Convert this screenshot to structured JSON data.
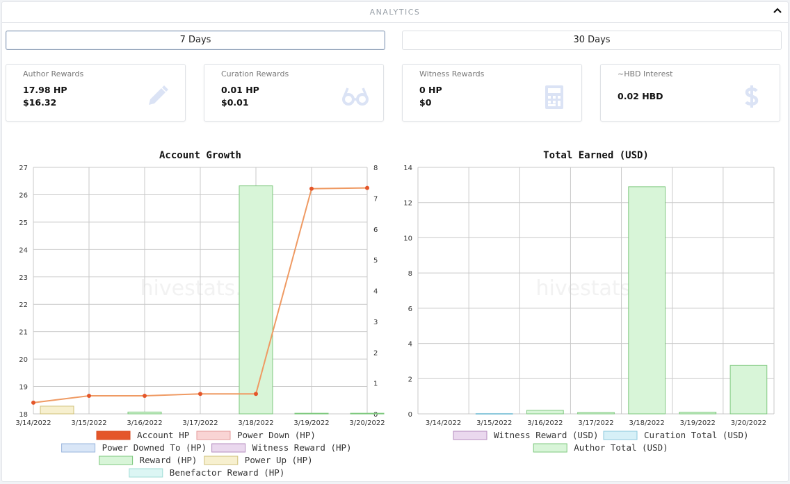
{
  "header": {
    "title": "ANALYTICS"
  },
  "tabs": [
    {
      "label": "7 Days",
      "active": true
    },
    {
      "label": "30 Days",
      "active": false
    }
  ],
  "cards": [
    {
      "label": "Author Rewards",
      "value1": "17.98 HP",
      "value2": "$16.32",
      "icon": "pencil-icon"
    },
    {
      "label": "Curation Rewards",
      "value1": "0.01 HP",
      "value2": "$0.01",
      "icon": "glasses-icon"
    },
    {
      "label": "Witness Rewards",
      "value1": "0 HP",
      "value2": "$0",
      "icon": "calculator-icon"
    },
    {
      "label": "~HBD Interest",
      "value1": "0.02 HBD",
      "value2": "",
      "icon": "dollar-icon"
    }
  ],
  "watermark": "hivestats.io",
  "chart_data": [
    {
      "type": "bar",
      "title": "Account Growth",
      "categories": [
        "3/14/2022",
        "3/15/2022",
        "3/16/2022",
        "3/17/2022",
        "3/18/2022",
        "3/19/2022",
        "3/20/2022"
      ],
      "y_left": {
        "min": 18,
        "max": 27,
        "ticks": [
          "27",
          "26",
          "25",
          "24",
          "23",
          "22",
          "21",
          "20",
          "19",
          "18"
        ]
      },
      "y_right": {
        "min": 0,
        "max": 8,
        "ticks": [
          "8",
          "7",
          "6",
          "5",
          "4",
          "3",
          "2",
          "1",
          "0"
        ]
      },
      "line_series": {
        "name": "Account HP",
        "axis": "left",
        "color": "#e4562a",
        "values": [
          18.41,
          18.66,
          18.66,
          18.73,
          18.73,
          26.22,
          26.25
        ]
      },
      "bar_series": [
        {
          "name": "Power Down (HP)",
          "fill": "#f9d4d4",
          "stroke": "#e49a9a",
          "values": [
            0,
            0,
            0,
            0,
            0,
            0,
            0
          ]
        },
        {
          "name": "Power Downed To (HP)",
          "fill": "#d9e6f7",
          "stroke": "#98b4dd",
          "values": [
            0,
            0,
            0,
            0,
            0,
            0,
            0
          ]
        },
        {
          "name": "Witness Reward (HP)",
          "fill": "#ead8ee",
          "stroke": "#b48cbf",
          "values": [
            0,
            0,
            0,
            0,
            0,
            0,
            0
          ]
        },
        {
          "name": "Reward (HP)",
          "fill": "#d8f5d8",
          "stroke": "#7ec87e",
          "values": [
            0,
            0,
            0.06,
            0,
            7.4,
            0.02,
            0.02
          ]
        },
        {
          "name": "Power Up (HP)",
          "fill": "#f7f0cf",
          "stroke": "#cfc07a",
          "values": [
            0.25,
            0,
            0,
            0,
            0,
            0,
            0
          ]
        },
        {
          "name": "Benefactor Reward (HP)",
          "fill": "#dcf6f4",
          "stroke": "#9fdcd6",
          "values": [
            0,
            0,
            0,
            0,
            0,
            0,
            0
          ]
        }
      ],
      "legend": [
        [
          "Account HP",
          "Power Down (HP)"
        ],
        [
          "Power Downed To (HP)",
          "Witness Reward (HP)"
        ],
        [
          "Reward (HP)",
          "Power Up (HP)"
        ],
        [
          "Benefactor Reward (HP)"
        ]
      ],
      "legend_colors": {
        "Account HP": {
          "fill": "#e4562a",
          "stroke": "#d84a1f"
        },
        "Power Down (HP)": {
          "fill": "#f9d4d4",
          "stroke": "#e49a9a"
        },
        "Power Downed To (HP)": {
          "fill": "#d9e6f7",
          "stroke": "#98b4dd"
        },
        "Witness Reward (HP)": {
          "fill": "#ead8ee",
          "stroke": "#b48cbf"
        },
        "Reward (HP)": {
          "fill": "#d8f5d8",
          "stroke": "#7ec87e"
        },
        "Power Up (HP)": {
          "fill": "#f7f0cf",
          "stroke": "#cfc07a"
        },
        "Benefactor Reward (HP)": {
          "fill": "#dcf6f4",
          "stroke": "#9fdcd6"
        }
      },
      "legend_position": "bottom",
      "grid": true
    },
    {
      "type": "bar",
      "title": "Total Earned (USD)",
      "categories": [
        "3/14/2022",
        "3/15/2022",
        "3/16/2022",
        "3/17/2022",
        "3/18/2022",
        "3/19/2022",
        "3/20/2022"
      ],
      "y": {
        "min": 0,
        "max": 14,
        "ticks": [
          "14",
          "12",
          "10",
          "8",
          "6",
          "4",
          "2",
          "0"
        ]
      },
      "series": [
        {
          "name": "Witness Reward (USD)",
          "fill": "#ead8ee",
          "stroke": "#b48cbf",
          "values": [
            0,
            0,
            0,
            0,
            0,
            0,
            0
          ]
        },
        {
          "name": "Curation Total (USD)",
          "fill": "#d6f0f7",
          "stroke": "#8cc9dc",
          "values": [
            0,
            0.02,
            0,
            0,
            0,
            0,
            0
          ]
        },
        {
          "name": "Author Total (USD)",
          "fill": "#d8f5d8",
          "stroke": "#7ec87e",
          "values": [
            0,
            0,
            0.2,
            0.08,
            12.9,
            0.1,
            2.75
          ]
        }
      ],
      "legend": [
        [
          "Witness Reward (USD)",
          "Curation Total (USD)"
        ],
        [
          "Author Total (USD)"
        ]
      ],
      "legend_position": "bottom",
      "grid": true
    }
  ]
}
